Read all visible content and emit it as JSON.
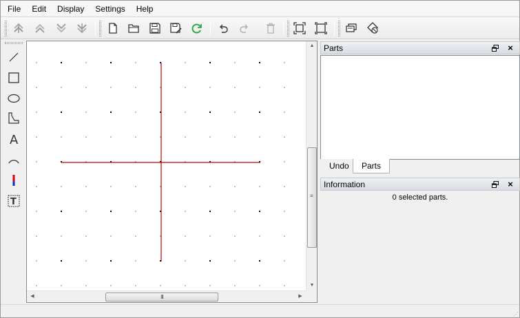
{
  "menu": {
    "items": [
      "File",
      "Edit",
      "Display",
      "Settings",
      "Help"
    ]
  },
  "toolbar": {
    "buttons": [
      "move-to-front-icon",
      "raise-icon",
      "lower-icon",
      "move-to-back-icon",
      "new-file-icon",
      "open-folder-icon",
      "save-icon",
      "save-as-icon",
      "reload-icon",
      "undo-icon",
      "redo-icon",
      "delete-icon",
      "zoom-fit-icon",
      "zoom-reset-icon",
      "edit-info-icon",
      "clear-selection-icon"
    ]
  },
  "tools": {
    "items": [
      "line-tool-icon",
      "rectangle-tool-icon",
      "ellipse-tool-icon",
      "polygon-tool-icon",
      "text-tool-icon",
      "arc-tool-icon",
      "terminal-tool-icon",
      "text-field-tool-icon"
    ],
    "text_tool_glyph": "A",
    "text_field_glyph": "T"
  },
  "colors": {
    "axis": "#c00000",
    "grid_dot": "#000000",
    "terminal_red": "#e00000",
    "terminal_blue": "#1030c0"
  },
  "scrollbars": {
    "h_grip": "III"
  },
  "docks": {
    "parts": {
      "title": "Parts"
    },
    "info": {
      "title": "Information",
      "text": "0 selected parts."
    },
    "float_icon": "float-icon",
    "close_glyph": "×"
  },
  "tabs": {
    "undo": "Undo",
    "parts": "Parts"
  }
}
